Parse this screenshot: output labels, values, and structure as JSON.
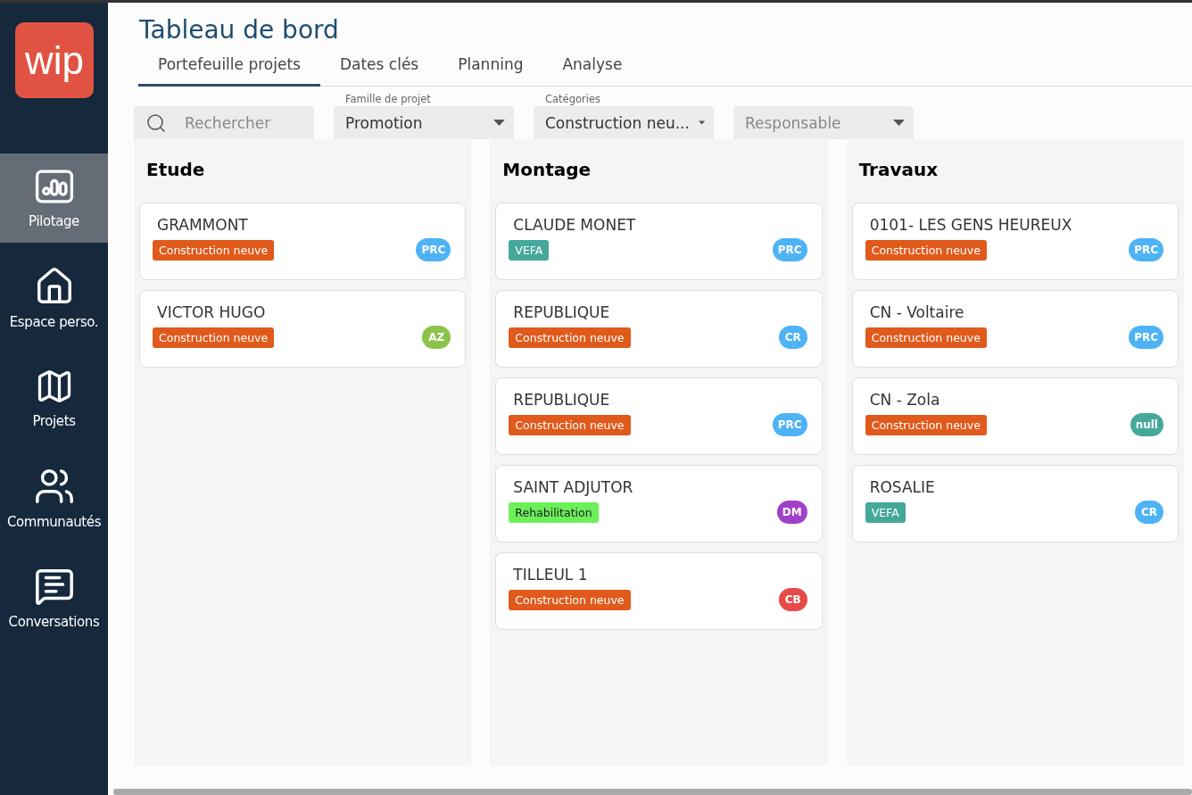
{
  "logo": {
    "text": "wip"
  },
  "nav": [
    {
      "label": "Pilotage",
      "kind": "chart",
      "selected": true
    },
    {
      "label": "Espace perso.",
      "kind": "home",
      "selected": false
    },
    {
      "label": "Projets",
      "kind": "map",
      "selected": false
    },
    {
      "label": "Communautés",
      "kind": "people",
      "selected": false
    },
    {
      "label": "Conversations",
      "kind": "chat",
      "selected": false
    }
  ],
  "title": "Tableau de bord",
  "tabs": [
    {
      "label": "Portefeuille projets",
      "selected": true
    },
    {
      "label": "Dates clés",
      "selected": false
    },
    {
      "label": "Planning",
      "selected": false
    },
    {
      "label": "Analyse",
      "selected": false
    }
  ],
  "search": {
    "placeholder": "Rechercher"
  },
  "filters": [
    {
      "label": "Famille de projet",
      "value": "Promotion"
    },
    {
      "label": "Catégories",
      "value": "Construction neu..."
    },
    {
      "placeholder": "Responsable"
    }
  ],
  "columns": [
    {
      "title": "Etude",
      "cards": [
        {
          "name": "GRAMMONT",
          "tag": {
            "text": "Construction neuve",
            "color": "#e05a1c"
          },
          "avatar": {
            "text": "PRC",
            "color": "#4eb3f5"
          }
        },
        {
          "name": "VICTOR HUGO",
          "tag": {
            "text": "Construction neuve",
            "color": "#e05a1c"
          },
          "avatar": {
            "text": "AZ",
            "color": "#8bc34a"
          }
        }
      ]
    },
    {
      "title": "Montage",
      "cards": [
        {
          "name": "CLAUDE MONET",
          "tag": {
            "text": "VEFA",
            "color": "#45a89b"
          },
          "avatar": {
            "text": "PRC",
            "color": "#4eb3f5"
          }
        },
        {
          "name": "REPUBLIQUE",
          "tag": {
            "text": "Construction neuve",
            "color": "#e05a1c"
          },
          "avatar": {
            "text": "CR",
            "color": "#4eb3f5"
          }
        },
        {
          "name": "REPUBLIQUE",
          "tag": {
            "text": "Construction neuve",
            "color": "#e05a1c"
          },
          "avatar": {
            "text": "PRC",
            "color": "#4eb3f5"
          }
        },
        {
          "name": "SAINT ADJUTOR",
          "tag": {
            "text": "Rehabilitation",
            "color": "#6cf05a"
          },
          "avatar": {
            "text": "DM",
            "color": "#a040c8"
          }
        },
        {
          "name": "TILLEUL 1",
          "tag": {
            "text": "Construction neuve",
            "color": "#e05a1c"
          },
          "avatar": {
            "text": "CB",
            "color": "#e84a4a"
          }
        }
      ]
    },
    {
      "title": "Travaux",
      "cards": [
        {
          "name": "0101- LES GENS HEUREUX",
          "tag": {
            "text": "Construction neuve",
            "color": "#e05a1c"
          },
          "avatar": {
            "text": "PRC",
            "color": "#4eb3f5"
          }
        },
        {
          "name": "CN - Voltaire",
          "tag": {
            "text": "Construction neuve",
            "color": "#e05a1c"
          },
          "avatar": {
            "text": "PRC",
            "color": "#4eb3f5"
          }
        },
        {
          "name": "CN - Zola",
          "tag": {
            "text": "Construction neuve",
            "color": "#e05a1c"
          },
          "avatar": {
            "text": "null",
            "color": "#45a89b"
          }
        },
        {
          "name": "ROSALIE",
          "tag": {
            "text": "VEFA",
            "color": "#45a89b"
          },
          "avatar": {
            "text": "CR",
            "color": "#4eb3f5"
          }
        }
      ]
    }
  ]
}
